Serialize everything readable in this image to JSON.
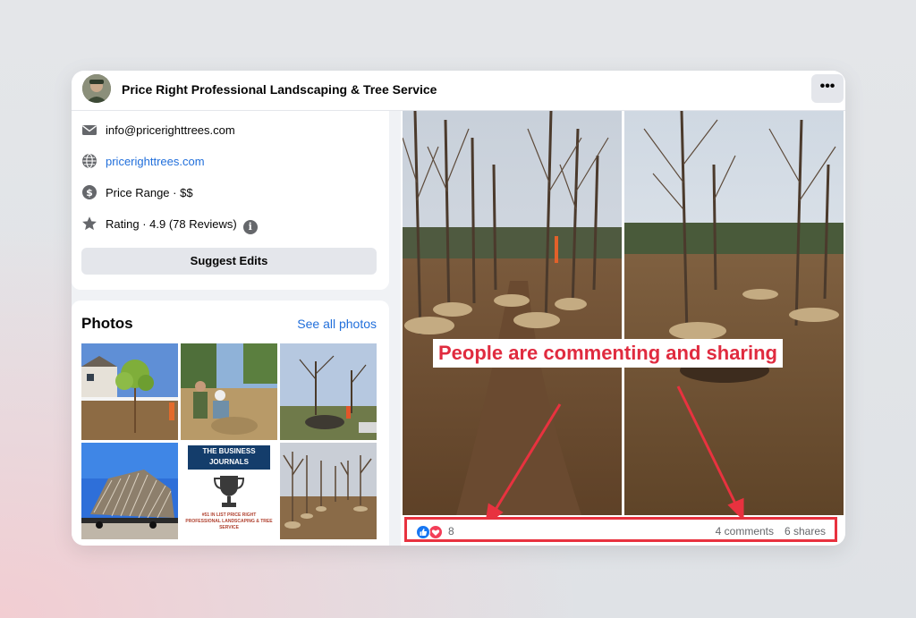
{
  "header": {
    "page_name": "Price Right Professional Landscaping & Tree Service",
    "more_label": "•••"
  },
  "info": {
    "email": "info@pricerighttrees.com",
    "website": "pricerighttrees.com",
    "price_range": "Price Range · $$",
    "rating": "Rating · 4.9 (78 Reviews)",
    "info_glyph": "i",
    "suggest_edits_label": "Suggest Edits"
  },
  "photos": {
    "title": "Photos",
    "see_all_label": "See all photos",
    "journal_title": "THE BUSINESS JOURNALS",
    "journal_subtitle": "#51 IN LIST PRICE RIGHT PROFESSIONAL LANDSCAPING & TREE SERVICE"
  },
  "post": {
    "annotation": "People are commenting and sharing",
    "reaction_count": "8",
    "comments": "4 comments",
    "shares": "6 shares"
  },
  "icons": {
    "email": "envelope-icon",
    "website": "globe-icon",
    "price": "dollar-circle-icon",
    "rating": "star-icon",
    "like": "like-reaction-icon",
    "love": "love-reaction-icon"
  },
  "colors": {
    "link": "#216fdb",
    "annotation": "#e02b3f",
    "like": "#1877f2",
    "love": "#f33e58"
  }
}
